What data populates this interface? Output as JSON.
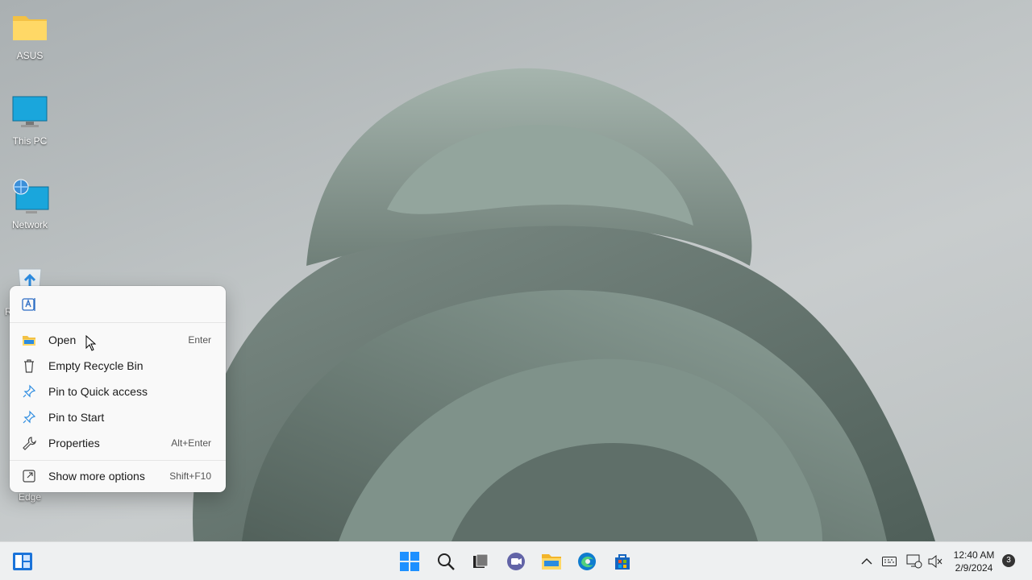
{
  "desktop": {
    "icons": [
      {
        "label": "ASUS",
        "icon": "folder-icon"
      },
      {
        "label": "This PC",
        "icon": "monitor-icon"
      },
      {
        "label": "Network",
        "icon": "network-icon"
      },
      {
        "label": "R",
        "icon": "recycle-bin-icon"
      },
      {
        "label": "Edge",
        "icon": "edge-icon"
      }
    ]
  },
  "context_menu": {
    "top_icon": "rename-icon",
    "items": [
      {
        "label": "Open",
        "shortcut": "Enter",
        "icon": "folder-open-icon"
      },
      {
        "label": "Empty Recycle Bin",
        "shortcut": "",
        "icon": "trash-icon"
      },
      {
        "label": "Pin to Quick access",
        "shortcut": "",
        "icon": "pin-icon"
      },
      {
        "label": "Pin to Start",
        "shortcut": "",
        "icon": "pin-icon"
      },
      {
        "label": "Properties",
        "shortcut": "Alt+Enter",
        "icon": "wrench-icon"
      },
      {
        "label": "Show more options",
        "shortcut": "Shift+F10",
        "icon": "share-icon"
      }
    ]
  },
  "taskbar": {
    "clock_time": "12:40 AM",
    "clock_date": "2/9/2024",
    "notification_count": "3",
    "apps": [
      "start-icon",
      "search-icon",
      "task-view-icon",
      "chat-icon",
      "file-explorer-icon",
      "edge-icon",
      "store-icon"
    ]
  }
}
